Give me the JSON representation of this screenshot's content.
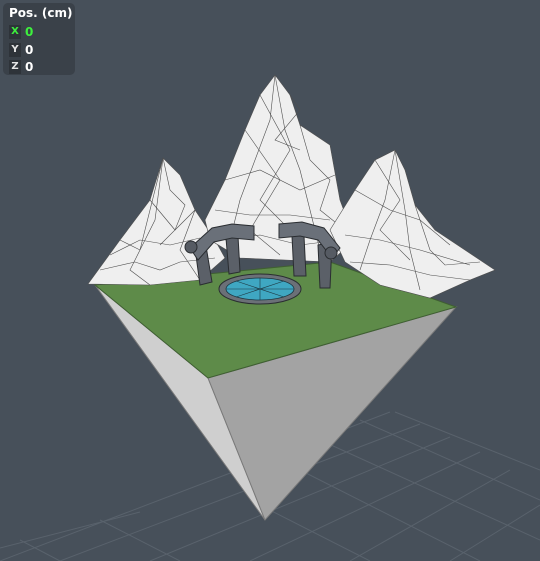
{
  "viewport": {
    "background_color": "#47505a",
    "grid_color": "#5a636d"
  },
  "position_panel": {
    "title": "Pos. (cm)",
    "axes": [
      {
        "label": "X",
        "value": "0",
        "active": true
      },
      {
        "label": "Y",
        "value": "0",
        "active": false
      },
      {
        "label": "Z",
        "value": "0",
        "active": false
      }
    ],
    "active_color": "#3df03d"
  },
  "scene": {
    "object": "floating-island-model",
    "colors": {
      "grass_top": "#5f8c4a",
      "cliff_left": "#c9c9c9",
      "cliff_right": "#a6a6a6",
      "mountain": "#eeeeee",
      "wireframe": "#555555",
      "pillar": "#5b6068",
      "pool_water": "#3fa7c2",
      "pool_rim": "#6b7077"
    }
  }
}
